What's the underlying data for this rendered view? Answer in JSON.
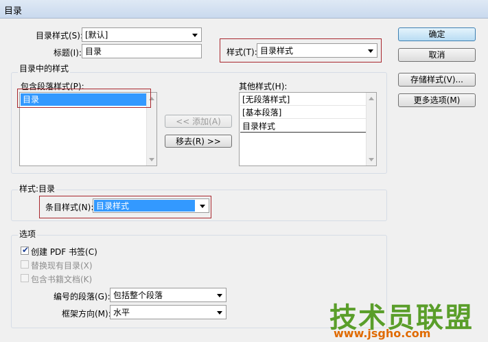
{
  "window": {
    "title": "目录"
  },
  "toc_style": {
    "label": "目录样式(S):",
    "value": "[默认]"
  },
  "title_field": {
    "label": "标题(I):",
    "value": "目录"
  },
  "style_field": {
    "label": "样式(T):",
    "value": "目录样式"
  },
  "styles_group": {
    "title": "目录中的样式",
    "include_label": "包含段落样式(P):",
    "include_items": [
      "目录"
    ],
    "other_label": "其他样式(H):",
    "other_items": [
      "[无段落样式]",
      "[基本段落]",
      "目录样式"
    ],
    "add_button": "<< 添加(A)",
    "remove_button": "移去(R) >>"
  },
  "style_section": {
    "title": "样式:目录",
    "entry_label": "条目样式(N):",
    "entry_value": "目录样式"
  },
  "options_section": {
    "title": "选项",
    "create_pdf": {
      "label": "创建 PDF 书签(C)",
      "checked": true
    },
    "replace_toc": {
      "label": "替换现有目录(X)",
      "checked": false
    },
    "include_book": {
      "label": "包含书籍文档(K)",
      "checked": false
    },
    "numbered_label": "编号的段落(G):",
    "numbered_value": "包括整个段落",
    "frame_label": "框架方向(M):",
    "frame_value": "水平"
  },
  "buttons": {
    "ok": "确定",
    "cancel": "取消",
    "save_style": "存储样式(V)...",
    "more_options": "更多选项(M)"
  },
  "watermark": {
    "line1": "技术员联盟",
    "line2": "www.jsgho.com"
  }
}
